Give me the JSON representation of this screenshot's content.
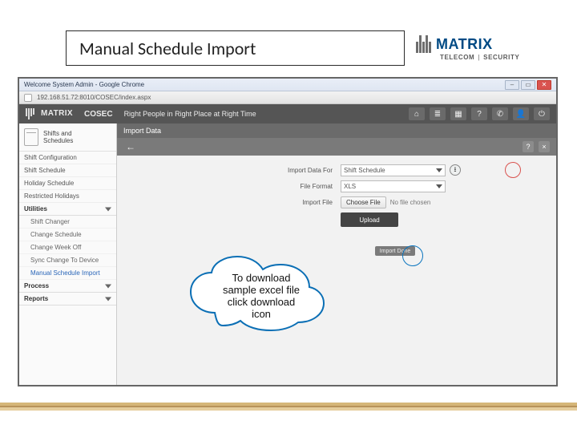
{
  "slide": {
    "title": "Manual Schedule Import"
  },
  "logo": {
    "brand": "MATRIX",
    "sub1": "TELECOM",
    "sub2": "SECURITY"
  },
  "chrome": {
    "title": "Welcome System Admin - Google Chrome",
    "url": "192.168.51.72:8010/COSEC/index.aspx"
  },
  "app_header": {
    "brand": "MATRIX",
    "product": "COSEC",
    "tagline": "Right People in Right Place at Right Time",
    "icons": [
      "home",
      "filter",
      "grid",
      "help",
      "phone",
      "user",
      "power"
    ]
  },
  "sidebar": {
    "section_title": "Shifts and\nSchedules",
    "items": [
      "Shift Configuration",
      "Shift Schedule",
      "Holiday Schedule",
      "Restricted Holidays"
    ],
    "utilities_label": "Utilities",
    "utilities": [
      "Shift Changer",
      "Change Schedule",
      "Change Week Off",
      "Sync Change To Device"
    ],
    "utilities_active": "Manual Schedule Import",
    "process_label": "Process",
    "reports_label": "Reports"
  },
  "panel": {
    "title": "Import Data",
    "back_icon": "←",
    "fields": {
      "import_for_label": "Import Data For",
      "import_for_value": "Shift Schedule",
      "format_label": "File Format",
      "format_value": "XLS",
      "file_label": "Import File",
      "choose_file": "Choose File",
      "no_file": "No file chosen",
      "upload": "Upload",
      "import_done": "Import Done"
    },
    "toolbar_icons": [
      "?",
      "×"
    ]
  },
  "callout": {
    "line1": "To download",
    "line2": "sample excel file",
    "line3": "click download",
    "line4": "icon"
  }
}
